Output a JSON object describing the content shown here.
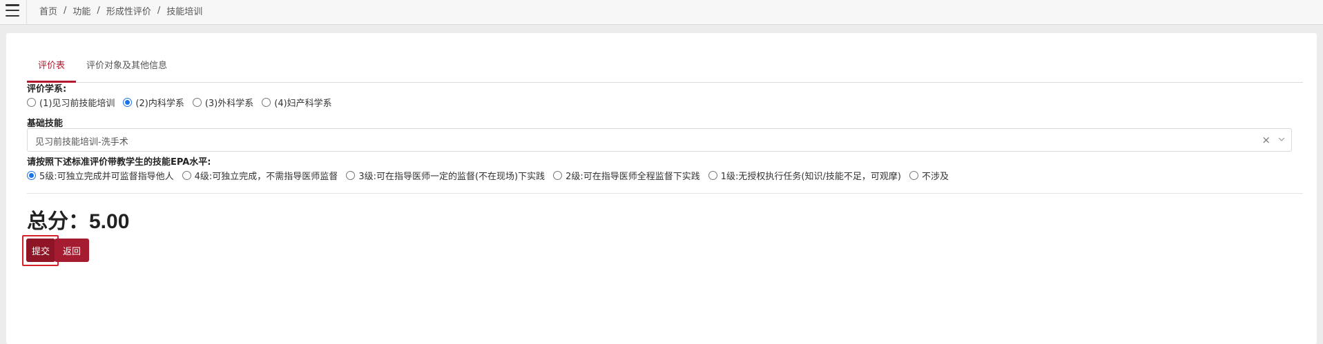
{
  "breadcrumb": [
    "首页",
    "功能",
    "形成性评价",
    "技能培训"
  ],
  "breadcrumb_separator": "/",
  "tabs": [
    {
      "label": "评价表",
      "active": true
    },
    {
      "label": "评价对象及其他信息",
      "active": false
    }
  ],
  "dept": {
    "label": "评价学系:",
    "options": [
      {
        "label": "(1)见习前技能培训",
        "checked": false
      },
      {
        "label": "(2)内科学系",
        "checked": true
      },
      {
        "label": "(3)外科学系",
        "checked": false
      },
      {
        "label": "(4)妇产科学系",
        "checked": false
      }
    ]
  },
  "skill": {
    "label": "基础技能",
    "value": "见习前技能培训-洗手术",
    "clear_glyph": "×"
  },
  "epa": {
    "label": "请按照下述标准评价带教学生的技能EPA水平:",
    "options": [
      {
        "label": "5级:可独立完成并可监督指导他人",
        "checked": true
      },
      {
        "label": "4级:可独立完成，不需指导医师监督",
        "checked": false
      },
      {
        "label": "3级:可在指导医师一定的监督(不在现场)下实践",
        "checked": false
      },
      {
        "label": "2级:可在指导医师全程监督下实践",
        "checked": false
      },
      {
        "label": "1级:无授权执行任务(知识/技能不足，可观摩)",
        "checked": false
      },
      {
        "label": "不涉及",
        "checked": false
      }
    ]
  },
  "total": "总分：5.00",
  "buttons": {
    "submit": "提交",
    "back": "返回"
  },
  "colors": {
    "accent": "#b5172f",
    "radio": "#1a73e8",
    "button": "#a51c30"
  },
  "icons": {
    "menu": "hamburger-icon",
    "select_arrow": "chevron-down-icon"
  }
}
